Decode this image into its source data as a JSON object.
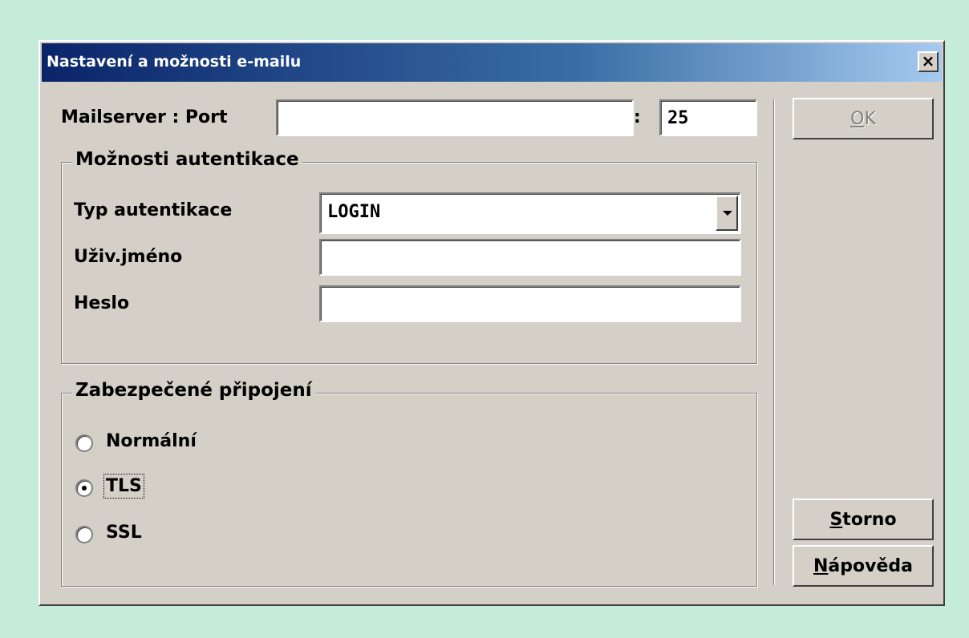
{
  "window": {
    "title": "Nastavení a možnosti e-mailu",
    "close_symbol": "×"
  },
  "mailserver": {
    "label": "Mailserver : Port",
    "host_value": "",
    "separator": ":",
    "port_value": "25"
  },
  "auth_group": {
    "legend": "Možnosti autentikace",
    "type_label": "Typ autentikace",
    "type_value": "LOGIN",
    "username_label": "Uživ.jméno",
    "username_value": "",
    "password_label": "Heslo",
    "password_value": ""
  },
  "secure_group": {
    "legend": "Zabezpečené připojení",
    "options": [
      {
        "label": "Normální",
        "checked": false
      },
      {
        "label": "TLS",
        "checked": true
      },
      {
        "label": "SSL",
        "checked": false
      }
    ]
  },
  "buttons": {
    "ok_first": "O",
    "ok_rest": "K",
    "cancel_first": "S",
    "cancel_rest": "torno",
    "help_first": "N",
    "help_rest": "ápověda"
  },
  "icons": {
    "close": "close-icon",
    "dropdown": "chevron-down-icon",
    "radio": "radio-icon"
  },
  "colors": {
    "desktop": "#c4ecd9",
    "face": "#d4d0c8",
    "title_start": "#0a246a",
    "title_end": "#a6caf0"
  }
}
